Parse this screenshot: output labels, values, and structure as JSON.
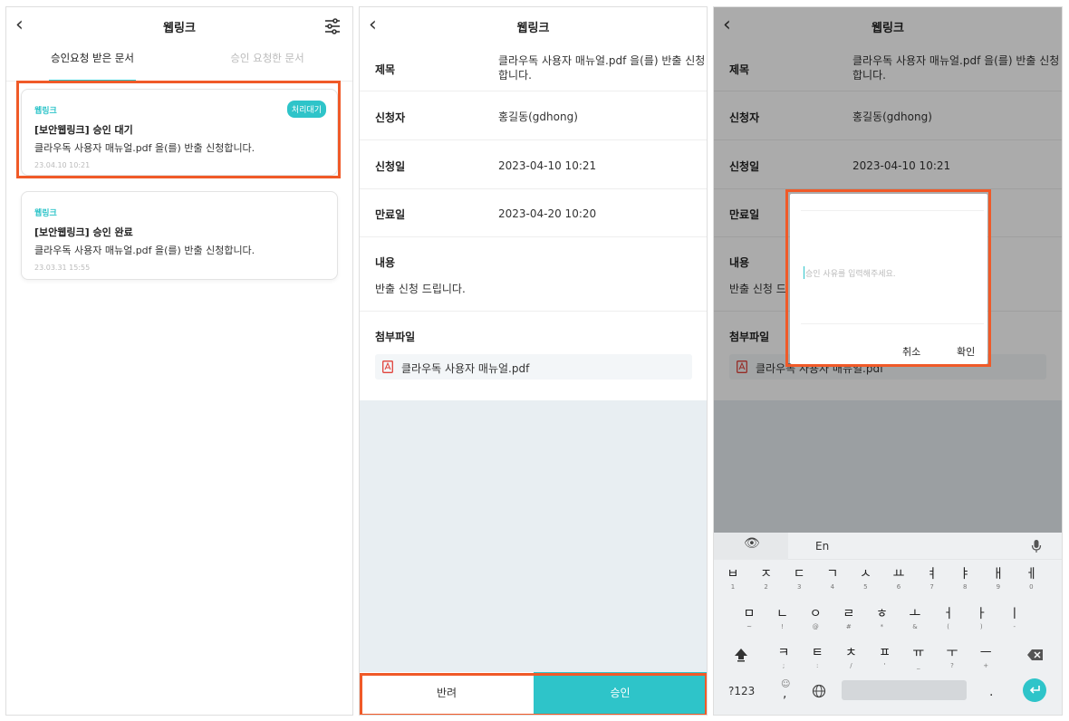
{
  "app_title": "웹링크",
  "colors": {
    "accent": "#2ec4c9",
    "highlight": "#f05a28"
  },
  "list_screen": {
    "tabs": [
      {
        "label": "승인요청 받은 문서",
        "active": true
      },
      {
        "label": "승인 요청한 문서",
        "active": false
      }
    ],
    "cards": [
      {
        "app": "웹링크",
        "title": "[보안웹링크] 승인 대기",
        "body": "클라우독 사용자 매뉴얼.pdf 을(를) 반출 신청합니다.",
        "date": "23.04.10 10:21",
        "badge": "처리대기"
      },
      {
        "app": "웹링크",
        "title": "[보안웹링크] 승인 완료",
        "body": "클라우독 사용자 매뉴얼.pdf 을(를) 반출 신청합니다.",
        "date": "23.03.31 15:55",
        "badge": ""
      }
    ]
  },
  "detail": {
    "subject_label": "제목",
    "subject_line1": "클라우독 사용자 매뉴얼.pdf 을(를) 반출 신청",
    "subject_line2": "합니다.",
    "applicant_label": "신청자",
    "applicant": "홍길동(gdhong)",
    "applied_label": "신청일",
    "applied": "2023-04-10 10:21",
    "expire_label": "만료일",
    "expire": "2023-04-20 10:20",
    "content_label": "내용",
    "content": "반출 신청 드립니다.",
    "content_truncated": "반출 신청 드",
    "attach_label": "첨부파일",
    "attachment": "클라우독 사용자 매뉴얼.pdf",
    "attachment_overlay": "클라우독 사용자 매뉴얼.pdf",
    "reject_label": "반려",
    "approve_label": "승인"
  },
  "dialog": {
    "placeholder": "승인 사유를 입력해주세요.",
    "cancel": "취소",
    "confirm": "확인"
  },
  "keyboard": {
    "lang": "En",
    "row1": [
      [
        "ㅂ",
        "1"
      ],
      [
        "ㅈ",
        "2"
      ],
      [
        "ㄷ",
        "3"
      ],
      [
        "ㄱ",
        "4"
      ],
      [
        "ㅅ",
        "5"
      ],
      [
        "ㅛ",
        "6"
      ],
      [
        "ㅕ",
        "7"
      ],
      [
        "ㅑ",
        "8"
      ],
      [
        "ㅐ",
        "9"
      ],
      [
        "ㅔ",
        "0"
      ]
    ],
    "row2": [
      [
        "ㅁ",
        "~"
      ],
      [
        "ㄴ",
        "!"
      ],
      [
        "ㅇ",
        "@"
      ],
      [
        "ㄹ",
        "#"
      ],
      [
        "ㅎ",
        "*"
      ],
      [
        "ㅗ",
        "&"
      ],
      [
        "ㅓ",
        "("
      ],
      [
        "ㅏ",
        ")"
      ],
      [
        "ㅣ",
        "-"
      ]
    ],
    "row3": [
      [
        "ㅋ",
        ";"
      ],
      [
        "ㅌ",
        ":"
      ],
      [
        "ㅊ",
        "/"
      ],
      [
        "ㅍ",
        "'"
      ],
      [
        "ㅠ",
        "_"
      ],
      [
        "ㅜ",
        "?"
      ],
      [
        "ㅡ",
        "+"
      ]
    ],
    "num_key": "?123",
    "comma": ",",
    "period": "."
  }
}
